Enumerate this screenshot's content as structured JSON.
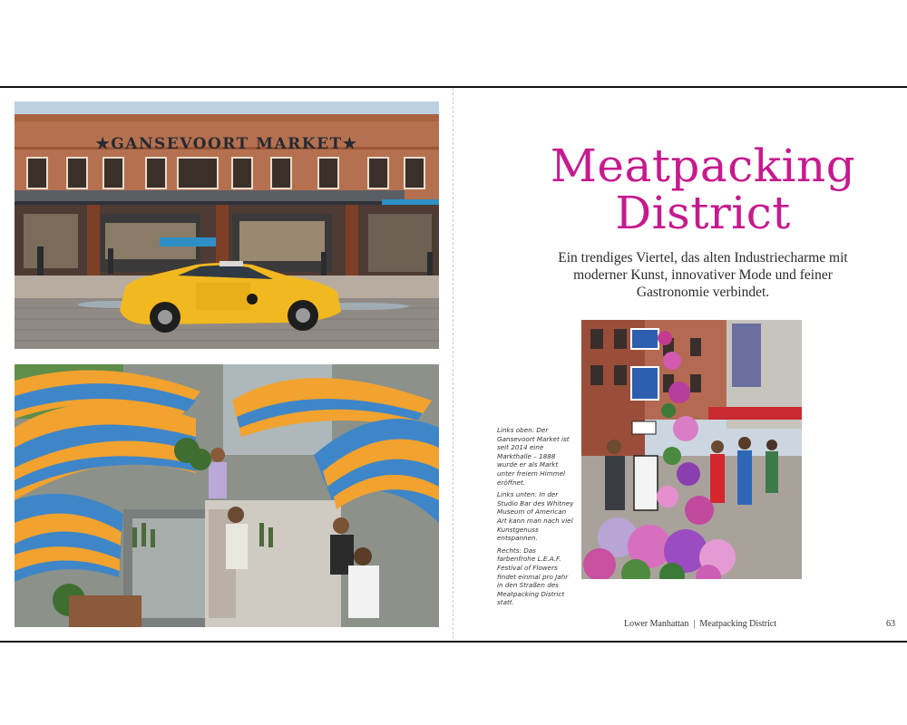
{
  "left_page": {
    "photo_market": {
      "sign_text": "★GANSEVOORT MARKET★"
    }
  },
  "right_page": {
    "title_line1": "Meatpacking",
    "title_line2": "District",
    "intro": "Ein trendiges Viertel, das alten Industriecharme mit moderner Kunst, innovativer Mode und feiner Gastronomie verbindet.",
    "captions": [
      "Links oben: Der Gansevoort Market ist seit 2014 eine Markthalle – 1888 wurde er als Markt unter freiem Himmel eröffnet.",
      "Links unten: In der Studio Bar des Whitney Museum of American Art kann man nach viel Kunstgenuss entspannen.",
      "Rechts: Das farbenfrohe L.E.A.F. Festival of Flowers findet einmal pro Jahr in den Straßen des Meatpacking District statt."
    ],
    "footer_section": "Lower Manhattan",
    "footer_separator": "|",
    "footer_chapter": "Meatpacking District",
    "page_number": "63"
  },
  "colors": {
    "title_magenta": "#c61a8e",
    "taxi_yellow": "#f2b81f",
    "umbrella_orange": "#f2a22e",
    "umbrella_blue": "#3f86c8"
  }
}
